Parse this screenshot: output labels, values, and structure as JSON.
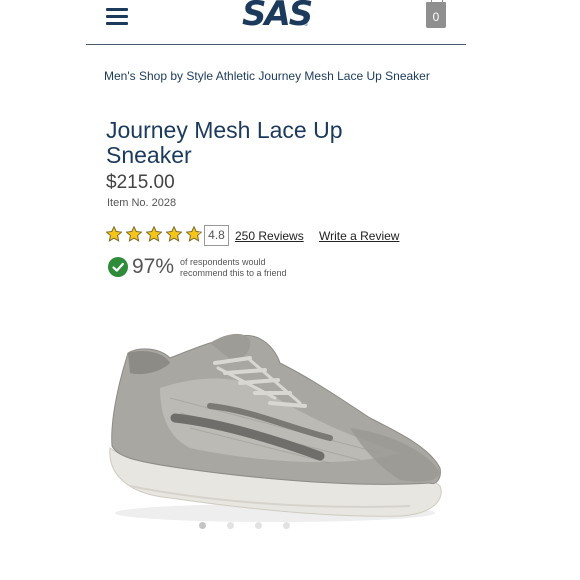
{
  "header": {
    "logo_text": "SAS",
    "logo_mark": "®",
    "menu_icon": "hamburger-menu-icon",
    "bag_icon": "shopping-bag-icon",
    "cart_count": "0"
  },
  "breadcrumb": {
    "items": [
      "Men's Shop",
      "by Style",
      "Athletic",
      "Journey Mesh Lace Up Sneaker"
    ]
  },
  "product": {
    "title": "Journey Mesh Lace Up Sneaker",
    "price": "$215.00",
    "item_number": "Item No. 2028",
    "rating": "4.8",
    "rating_out_of_5": 4.8,
    "reviews_link": "250 Reviews",
    "write_review_link": "Write a Review",
    "recommend_percent": "97%",
    "recommend_text": "of respondents would recommend this to a friend"
  },
  "gallery": {
    "image_count": 4,
    "active_index": 0
  },
  "colors": {
    "brand_navy": "#1b3a5c",
    "star_gold": "#f5c518",
    "check_green": "#2e8b3a",
    "dot_active": "#c4c4c4",
    "dot_inactive": "#e2e2e2"
  }
}
